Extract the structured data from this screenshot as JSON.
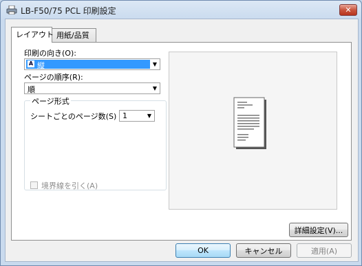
{
  "window": {
    "title": "LB-F50/75 PCL 印刷設定",
    "close_label": "✕"
  },
  "tabs": [
    {
      "label": "レイアウト",
      "active": true
    },
    {
      "label": "用紙/品質",
      "active": false
    }
  ],
  "layout": {
    "orientation_label": "印刷の向き(O):",
    "orientation_value": "縦",
    "orientation_icon": "A",
    "page_order_label": "ページの順序(R):",
    "page_order_value": "順",
    "page_format_group": "ページ形式",
    "pages_per_sheet_label": "シートごとのページ数(S)",
    "pages_per_sheet_value": "1",
    "draw_borders_label": "境界線を引く(A)",
    "draw_borders_checked": false,
    "advanced_button": "詳細設定(V)..."
  },
  "buttons": {
    "ok": "OK",
    "cancel": "キャンセル",
    "apply": "適用(A)"
  },
  "colors": {
    "selection": "#3399ff",
    "title_bar": "#c9daee",
    "close": "#c9553e"
  },
  "icons": {
    "printer": "printer-icon",
    "dropdown": "chevron-down-icon",
    "close": "close-icon"
  }
}
